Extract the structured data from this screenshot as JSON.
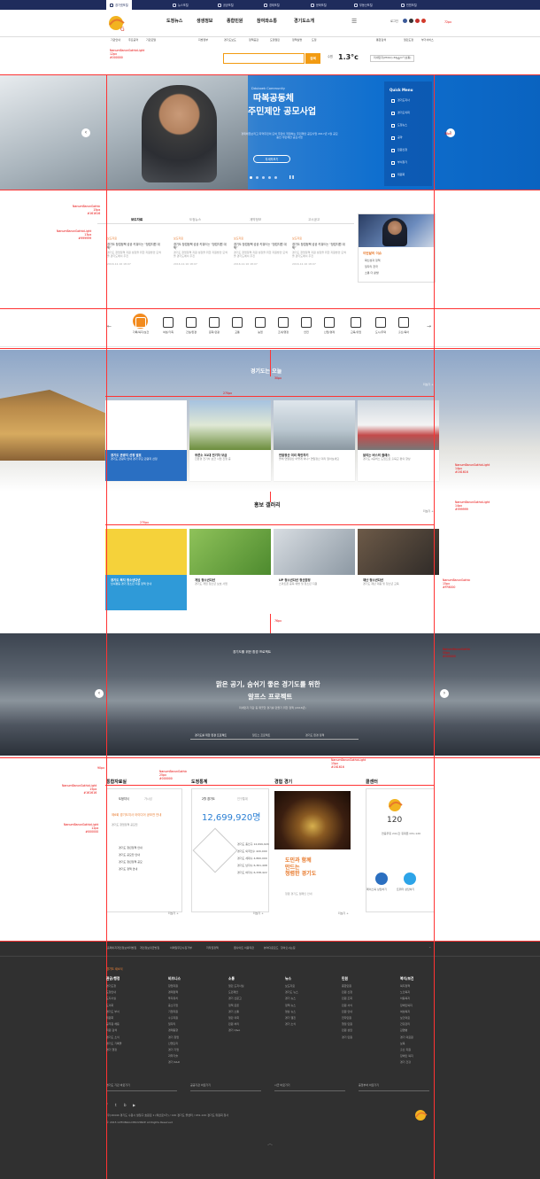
{
  "topnav": {
    "items": [
      "경기넷포털",
      "뉴스포털",
      "공공포털",
      "경제포털",
      "문화포털",
      "부동산포털",
      "민원포털"
    ]
  },
  "header": {
    "gnb": [
      "도정뉴스",
      "생생정보",
      "종합민원",
      "참여와소통",
      "경기도소개"
    ],
    "utils": [
      "로그인",
      "통합검색"
    ],
    "sub": [
      "기관안내",
      "주요공약",
      "기관포털"
    ]
  },
  "submenu": [
    "지방정부",
    "경기도보도",
    "정책공감",
    "도정열린",
    "정책실명",
    "도정",
    "열린도정",
    "부가서비스"
  ],
  "search": {
    "placeholder": "",
    "button": "검색"
  },
  "weather": {
    "label": "수원",
    "temp": "1.3°c",
    "info": "미세먼지(PM10) 86㎍/m³(보통)"
  },
  "hero": {
    "sub": "Dduboek Community",
    "title1": "따복공동체",
    "title2": "주민제안 공모사업",
    "desc": "경제체질보리고 지역주민이 모여 주민이 직접하는 주민제안 공모사업 2017년 1월 공모중인 주민제안 공모사업",
    "button": "자세히보기"
  },
  "quick": {
    "title": "Quick Menu",
    "items": [
      "경기도지사",
      "경기도의회",
      "도정뉴스",
      "공약",
      "민원신청",
      "부서찾기",
      "위원회"
    ]
  },
  "news": {
    "tabs": [
      "보도자료",
      "도정뉴스",
      "계약정보",
      "고시공고"
    ],
    "cards": [
      {
        "tag": "보도자료",
        "title": "경기도 창업정책 성공 키워드는 “창업지원 대책”",
        "desc": "경기도 창업정책 지원 성장을 위한 지원방안 모색을 경기도에서 추진",
        "date": "2016.12.16 18:07"
      },
      {
        "tag": "보도자료",
        "title": "경기도 창업정책 성공 키워드는 “창업지원 대책”",
        "desc": "경기도 창업정책 지원 성장을 위한 지원방안 모색을 경기도에서 추진",
        "date": "2016.12.16 18:07"
      },
      {
        "tag": "보도자료",
        "title": "경기도 창업정책 성공 키워드는 “창업지원 대책”",
        "desc": "경기도 창업정책 지원 성장을 위한 지원방안 모색을 경기도에서 추진",
        "date": "2016.12.16 18:07"
      },
      {
        "tag": "보도자료",
        "title": "경기도 창업정책 성공 키워드는 “창업지원 대책”",
        "desc": "경기도 창업정책 지원 성장을 위한 지원방안 모색을 경기도에서 추진",
        "date": "2016.12.16 18:07"
      }
    ],
    "topic": {
      "title": "이번달의 이슈",
      "items": [
        "확신성과 정책",
        "일자리 천국",
        "소통 더 활발"
      ]
    }
  },
  "icons": [
    "기록/복지/보건",
    "여성/가족",
    "건설/환경",
    "문화/관광",
    "교통",
    "농업",
    "조세/행정",
    "안전",
    "산업/경제",
    "교육/취업",
    "도시/주택",
    "출산/육아"
  ],
  "today": {
    "title": "경기도는 오늘",
    "cards": [
      {
        "title": "경기도 관광지 선정 발표",
        "desc": "경기도 관광지 안내 경기 주요 관광지 선정"
      },
      {
        "title": "푸른소 31대 전기차 보급",
        "desc": "친환경 전기차 보급 사업 진행 중"
      },
      {
        "title": "연말정산 미리 확인하기",
        "desc": "올해 연말정산 어떻게 하나? 연말정산 미리 알아보세요"
      },
      {
        "title": "달리는 버스의 클래스",
        "desc": "경기도 2층버스 도입으로 출퇴근 편의 향상"
      }
    ]
  },
  "promo": {
    "title": "홍보 갤러리",
    "cards": [
      {
        "title": "경기도 복지 청소년다년",
        "desc": "남녀평등 경기 청소년 지원 정책 안내"
      },
      {
        "title": "게임 청소년다년",
        "desc": "경기도 게임 청소년 보호 사업"
      },
      {
        "title": "UP 청소년다년 청산원정",
        "desc": "스마트폰 중독 예방 및 청소년 지원"
      },
      {
        "title": "재난 청소년다년",
        "desc": "경기도 재난 대응 및 청소년 교육"
      }
    ]
  },
  "alps": {
    "sub": "경기도를 위한 환경 프로젝트",
    "title1": "맑은 공기, 숨쉬기 좋은 경기도를 위한",
    "title2": "알프스 프로젝트",
    "desc": "미세먼지 저감 등 깨끗한 경기를 만들기 위한 정책 (2016년)",
    "tabs": [
      "경기도를 위한 환경 프로젝트",
      "알프스 프로젝트",
      "경기도 환경 정책"
    ]
  },
  "widgets": {
    "data": {
      "title": "통합자료실",
      "tabs": [
        "도정지식",
        "가시성",
        "정책"
      ],
      "items": [
        "제6회 경기도지사 아이디어 공모전 안내",
        "경기도 창업정책 공모전",
        "경기도 청년정책 안내",
        "경기도 공모전 안내",
        "경기도 청년정책 공모",
        "경기도 정책 안내"
      ]
    },
    "stats": {
      "title": "도정통계",
      "tabs": [
        "2월 경기도",
        "인구통계"
      ],
      "number": "12,699,920명",
      "rows": [
        "경기도 총인구 12,699,920",
        "경기도 외국인수 420,000",
        "경기도 세대수 4,860,000",
        "경기도 남자수 6,361,498",
        "경기도 여자수 6,338,422"
      ]
    },
    "concert": {
      "title": "경험 경기",
      "line1": "도민과 함께",
      "line2": "만드는",
      "line3": "청렴한 경기도",
      "desc": "청렴 경기도 캠페인 안내"
    },
    "call": {
      "title": "콜센터",
      "number": "120",
      "desc": "연중무휴 24시간 휴대폰 031-120",
      "buttons": [
        "페이스북 상담하기",
        "트위터 상담하기"
      ]
    },
    "more": "더보기 +"
  },
  "footer": {
    "links": [
      "홈페이지개인정보처리방침",
      "개인정보취급방침",
      "이메일무단수집거부",
      "저작권정책",
      "웹사이트 이용약관",
      "뷰어다운로드",
      "찾아오시는길"
    ],
    "cols": [
      {
        "title": "경기도 새소식",
        "items": []
      },
      {
        "title": "관공/행정",
        "items": [
          "경기도청",
          "도청안내",
          "도지사실",
          "도의회",
          "경기도 부서",
          "위원회",
          "공무원 채용",
          "직원 검색",
          "경기도 소식",
          "경기도 기록물",
          "경기 행정"
        ]
      },
      {
        "title": "비즈니스",
        "items": [
          "창업지원",
          "경제정책",
          "투자유치",
          "중소기업",
          "기업지원",
          "수출지원",
          "일자리",
          "경제동향",
          "경기 창업",
          "산업단지",
          "경기 기업",
          "과학기술",
          "경기 R&D"
        ]
      },
      {
        "title": "소통",
        "items": [
          "열린 도지사실",
          "도민제안",
          "경기 신문고",
          "정책 토론",
          "경기 소통",
          "열린 의회",
          "민원 처리",
          "경기 Q&A"
        ]
      },
      {
        "title": "뉴스",
        "items": [
          "보도자료",
          "경기도 뉴스",
          "경기 뉴스",
          "정책 뉴스",
          "영상 뉴스",
          "경기 웹진",
          "경기 소식"
        ]
      },
      {
        "title": "민원",
        "items": [
          "종합민원",
          "민원 신청",
          "민원 조회",
          "민원 서식",
          "민원 안내",
          "전자민원",
          "행정 민원",
          "민원 상담",
          "경기 민원"
        ]
      },
      {
        "title": "복지/보건",
        "items": [
          "복지정책",
          "노인복지",
          "아동복지",
          "장애인복지",
          "여성복지",
          "보건의료",
          "건강관리",
          "감염병",
          "경기 의료원",
          "보육",
          "출산 지원",
          "장애인 복지",
          "경기 건강"
        ]
      }
    ],
    "selects": [
      "경기도 기관 바로가기",
      "공공기관 바로가기",
      "시군 바로가기",
      "중앙부처 바로가기"
    ],
    "address": "(우)16444 경기도 수원시 팔달구 효원로 1 (매산로3가) / 120 경기도 콜센터 / 031-120 경기도 위원회 청사",
    "copyright": "© 2015 GYEONGGI PROVINCE All Rights Reserved"
  },
  "specs": {
    "font1": "NanumBarunGothic",
    "font2": "NanumBarunGothicLight",
    "c1": "#000000",
    "c2": "#161616",
    "c3": "#999999",
    "c4": "#FF8000",
    "s1": "12px",
    "s2": "15px",
    "s3": "13px",
    "s4": "14px",
    "s5": "24px",
    "s6": "50px",
    "s7": "25px",
    "s8": "270px",
    "s9": "30px",
    "s10": "72px",
    "s11": "38px",
    "s12": "76px",
    "s13": "90px"
  }
}
